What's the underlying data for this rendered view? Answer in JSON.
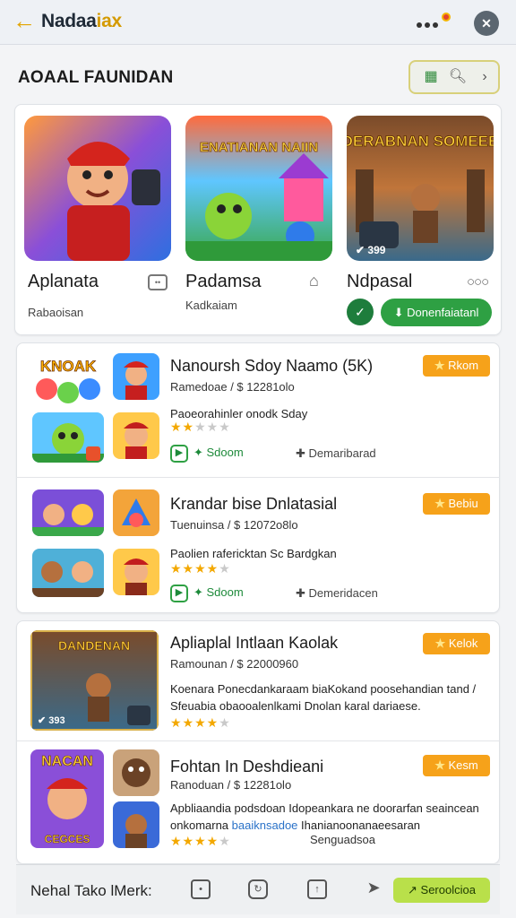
{
  "header": {
    "back_icon": "back-arrow-icon",
    "brand_main": "Nadaa",
    "brand_accent": "iax",
    "menu_icon": "more-dots-icon",
    "avatar_icon": "profile-icon"
  },
  "section": {
    "title": "AOAAL FAUNIDAN",
    "tools": [
      "list-icon",
      "search-icon",
      "chevron-right-icon"
    ]
  },
  "featured": [
    {
      "name": "Aplanata",
      "sub": "Rabaoisan",
      "icon": "chat-icon"
    },
    {
      "name": "Padamsa",
      "sub": "Kadkaiam",
      "icon": "house-icon"
    },
    {
      "name": "Ndpasal",
      "sub": "",
      "icon": "more-dots-icon",
      "img_counter": "✔ 399"
    }
  ],
  "featured_img_text": {
    "second": "ENATIANAN NAIIN",
    "third": "DERABNAN SOMEEE"
  },
  "featured_download": "Donenfaiatanl",
  "list": [
    {
      "title": "Nanoursh Sdoy Naamo (5K)",
      "meta": "Ramedoae / $ 12281olo",
      "desc": "Paoeorahinler onodk Sday",
      "badge": "Rkom",
      "action": "Sdoom",
      "link": "Demaribarad",
      "stars_on": 2,
      "stars_total": 5,
      "thumb_text": "KNOAK"
    },
    {
      "title": "Krandar bise Dnlatasial",
      "meta": "Tuenuinsa / $ 12072o8lo",
      "desc": "Paolien rafericktan Sc Bardgkan",
      "badge": "Bebiu",
      "action": "Sdoom",
      "link": "Demeridacen",
      "stars_on": 4,
      "stars_total": 5,
      "thumb_text": ""
    }
  ],
  "list2": [
    {
      "title": "Apliaplal Intlaan Kaolak",
      "meta": "Ramounan / $ 22000960",
      "desc": "Koenara Ponecdankaraam biaKokand poosehandian tand / Sfeuabia obaooalenlkami Dnolan karal dariaese.",
      "badge": "Kelok",
      "stars_on": 4,
      "stars_total": 5,
      "thumb_text": "DANDENAN",
      "thumb_counter": "✔ 393"
    },
    {
      "title": "Fohtan In Deshdieani",
      "meta": "Ranoduan / $ 12281olo",
      "desc": "Apbliaandia podsdoan Idopeankara ne doorarfan seaincean onkomarna",
      "desc_link": "baaiknsadoe",
      "desc_tail": "Ihanianoonanaeesaran",
      "sub_note": "Senguadsoa",
      "badge": "Kesm",
      "stars_on": 4,
      "stars_total": 5,
      "thumb_text": "NACAN",
      "thumb_sub": "CEGCES"
    }
  ],
  "bottom": {
    "label": "Nehal Tako lMerk:",
    "icons": [
      "bookmark-icon",
      "refresh-icon",
      "share-icon",
      "send-icon"
    ],
    "cta": "Seroolcioa"
  },
  "colors": {
    "accent": "#f6a21a",
    "green": "#2ea043",
    "brand_accent": "#d49a00"
  }
}
